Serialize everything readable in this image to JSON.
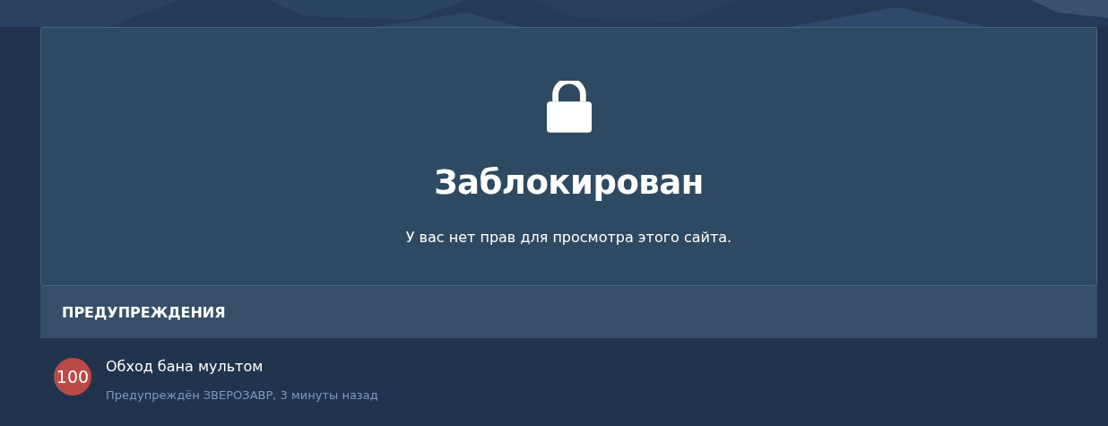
{
  "block": {
    "title": "Заблокирован",
    "message": "У вас нет прав для просмотра этого сайта."
  },
  "warnings": {
    "heading": "ПРЕДУПРЕЖДЕНИЯ",
    "items": [
      {
        "points": "100",
        "color": "#b94a48",
        "title": "Обход бана мультом",
        "meta": "Предупреждён ЗВЕРОЗАВР, 3 минуты назад"
      }
    ]
  }
}
